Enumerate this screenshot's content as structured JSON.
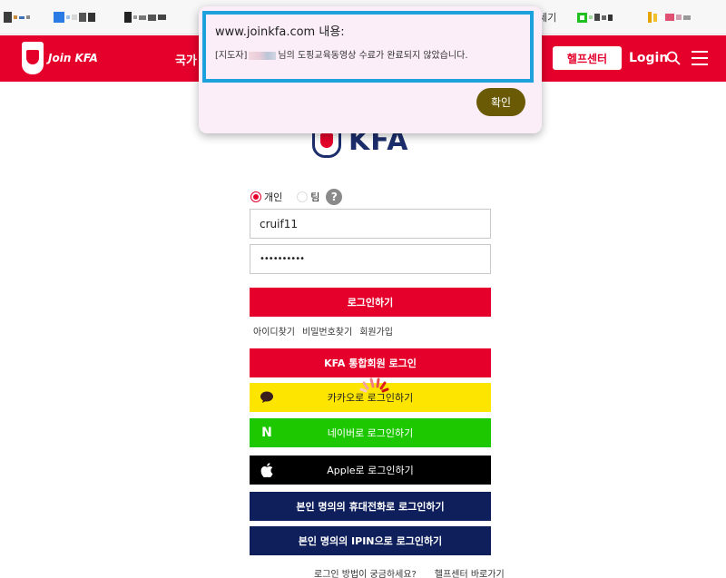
{
  "bookmarks": {
    "item5_label": "세기"
  },
  "header": {
    "logo_text": "Join KFA",
    "nav_item_label": "국가",
    "help_center_label": "헬프센터",
    "login_label": "Login"
  },
  "main_logo": {
    "text": "KFA"
  },
  "login_form": {
    "member_type_individual": "개인",
    "member_type_team": "팀",
    "help_icon_glyph": "?",
    "user_id_value": "cruif11",
    "password_mask": "••••••••••",
    "login_button_label": "로그인하기",
    "find_id_label": "아이디찾기",
    "find_password_label": "비밀번호찾기",
    "signup_label": "회원가입"
  },
  "social_login": {
    "kfa_label": "KFA 통합회원 로그인",
    "kakao_label": "카카오로 로그인하기",
    "naver_label": "네이버로 로그인하기",
    "naver_icon_glyph": "N",
    "apple_label": "Apple로 로그인하기",
    "phone_label": "본인 명의의 휴대전화로 로그인하기",
    "ipin_label": "본인 명의의 IPIN으로 로그인하기"
  },
  "footer_links": {
    "question_label": "로그인 방법이 궁금하세요?",
    "help_center_link_label": "헬프센터 바로가기"
  },
  "alert_dialog": {
    "title": "www.joinkfa.com 내용:",
    "message_prefix": "[지도자]",
    "message_suffix": "님의 도핑교육동영상 수료가 완료되지 않았습니다.",
    "ok_label": "확인"
  },
  "colors": {
    "brand_red": "#e4002b",
    "kakao_yellow": "#fee500",
    "naver_green": "#1ec800",
    "navy": "#0e1f5c",
    "dialog_ok": "#6b5a05",
    "dialog_highlight": "#1da1dc"
  }
}
